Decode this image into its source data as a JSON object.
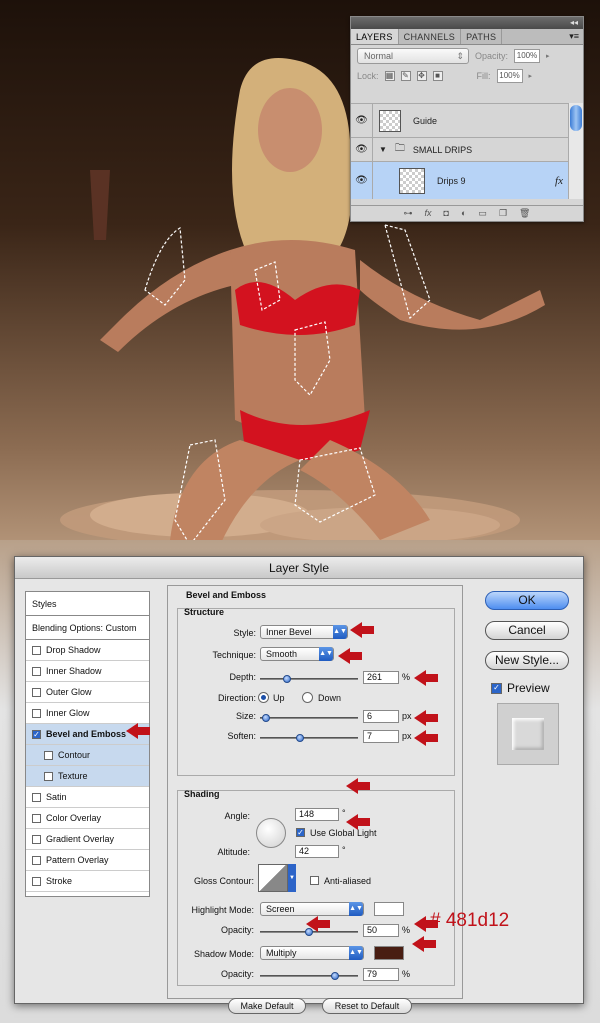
{
  "layers_panel": {
    "collapse_glyph": "◂◂",
    "tabs": [
      "LAYERS",
      "CHANNELS",
      "PATHS"
    ],
    "menu_glyph": "▾≡",
    "blend_mode": "Normal",
    "opacity_label": "Opacity:",
    "opacity_value": "100%",
    "lock_label": "Lock:",
    "fill_label": "Fill:",
    "fill_value": "100%",
    "layers": [
      {
        "name": "Guide"
      },
      {
        "name": "SMALL DRIPS"
      },
      {
        "name": "Drips 9",
        "fx": "fx"
      }
    ],
    "bottom_icons": [
      "link-icon",
      "fx-icon",
      "mask-icon",
      "adjustment-icon",
      "folder-icon",
      "new-layer-icon",
      "trash-icon"
    ]
  },
  "dialog": {
    "title": "Layer Style",
    "styles_list": {
      "header": "Styles",
      "blending": "Blending Options: Custom",
      "items": [
        {
          "label": "Drop Shadow",
          "checked": false
        },
        {
          "label": "Inner Shadow",
          "checked": false
        },
        {
          "label": "Outer Glow",
          "checked": false
        },
        {
          "label": "Inner Glow",
          "checked": false
        },
        {
          "label": "Bevel and Emboss",
          "checked": true,
          "selected": true
        },
        {
          "label": "Contour",
          "checked": false,
          "sub": true
        },
        {
          "label": "Texture",
          "checked": false,
          "sub": true
        },
        {
          "label": "Satin",
          "checked": false
        },
        {
          "label": "Color Overlay",
          "checked": false
        },
        {
          "label": "Gradient Overlay",
          "checked": false
        },
        {
          "label": "Pattern Overlay",
          "checked": false
        },
        {
          "label": "Stroke",
          "checked": false
        }
      ]
    },
    "section_title": "Bevel and Emboss",
    "structure": {
      "title": "Structure",
      "style_label": "Style:",
      "style_value": "Inner Bevel",
      "technique_label": "Technique:",
      "technique_value": "Smooth",
      "depth_label": "Depth:",
      "depth_value": "261",
      "depth_unit": "%",
      "direction_label": "Direction:",
      "direction_up": "Up",
      "direction_down": "Down",
      "size_label": "Size:",
      "size_value": "6",
      "size_unit": "px",
      "soften_label": "Soften:",
      "soften_value": "7",
      "soften_unit": "px"
    },
    "shading": {
      "title": "Shading",
      "angle_label": "Angle:",
      "angle_value": "148",
      "angle_unit": "°",
      "global_light": "Use Global Light",
      "altitude_label": "Altitude:",
      "altitude_value": "42",
      "altitude_unit": "°",
      "gloss_label": "Gloss Contour:",
      "anti_aliased": "Anti-aliased",
      "highlight_label": "Highlight Mode:",
      "highlight_value": "Screen",
      "highlight_opacity_label": "Opacity:",
      "highlight_opacity_value": "50",
      "highlight_opacity_unit": "%",
      "shadow_label": "Shadow Mode:",
      "shadow_value": "Multiply",
      "shadow_opacity_label": "Opacity:",
      "shadow_opacity_value": "79",
      "shadow_opacity_unit": "%"
    },
    "make_default": "Make Default",
    "reset_default": "Reset to Default",
    "buttons": {
      "ok": "OK",
      "cancel": "Cancel",
      "new_style": "New Style...",
      "preview": "Preview"
    },
    "highlight_color": "#ffffff",
    "shadow_color": "#481d12"
  },
  "annotation_hex": "# 481d12",
  "annotation_color": "#c1121a",
  "slider_levels": {
    "depth": 0.26,
    "size": 0.02,
    "soften": 0.4,
    "highlight_opacity": 0.5,
    "shadow_opacity": 0.79
  }
}
